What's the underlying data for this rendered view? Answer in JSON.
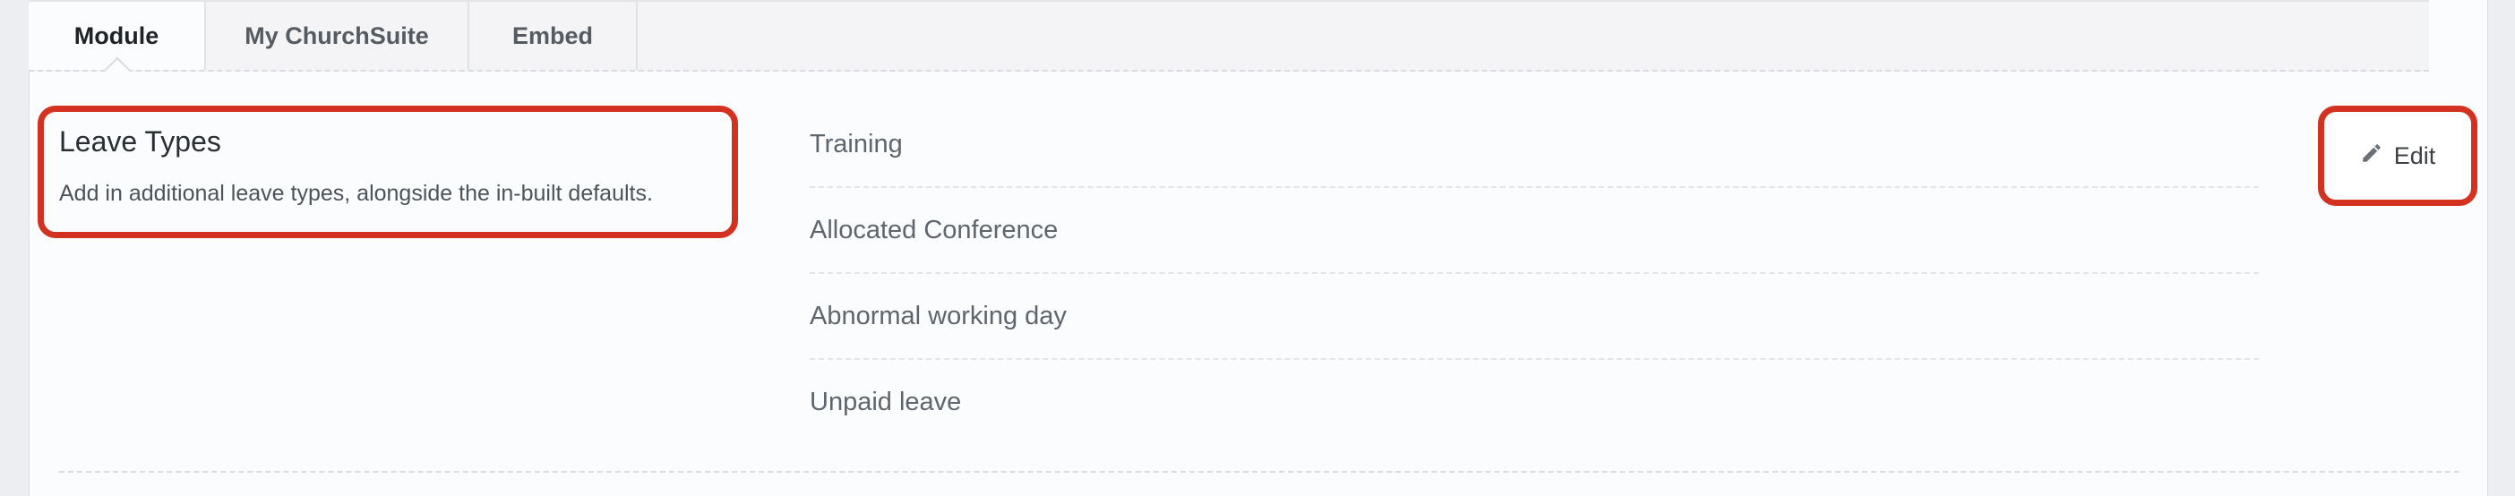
{
  "tabs": [
    {
      "label": "Module",
      "active": true
    },
    {
      "label": "My ChurchSuite",
      "active": false
    },
    {
      "label": "Embed",
      "active": false
    }
  ],
  "section": {
    "title": "Leave Types",
    "description": "Add in additional leave types, alongside the in-built defaults."
  },
  "leave_types": [
    "Training",
    "Allocated Conference",
    "Abnormal working day",
    "Unpaid leave"
  ],
  "edit_button": {
    "label": "Edit",
    "icon": "pencil-icon"
  },
  "colors": {
    "highlight": "#d2321f",
    "active_tab_text": "#1f2328"
  }
}
